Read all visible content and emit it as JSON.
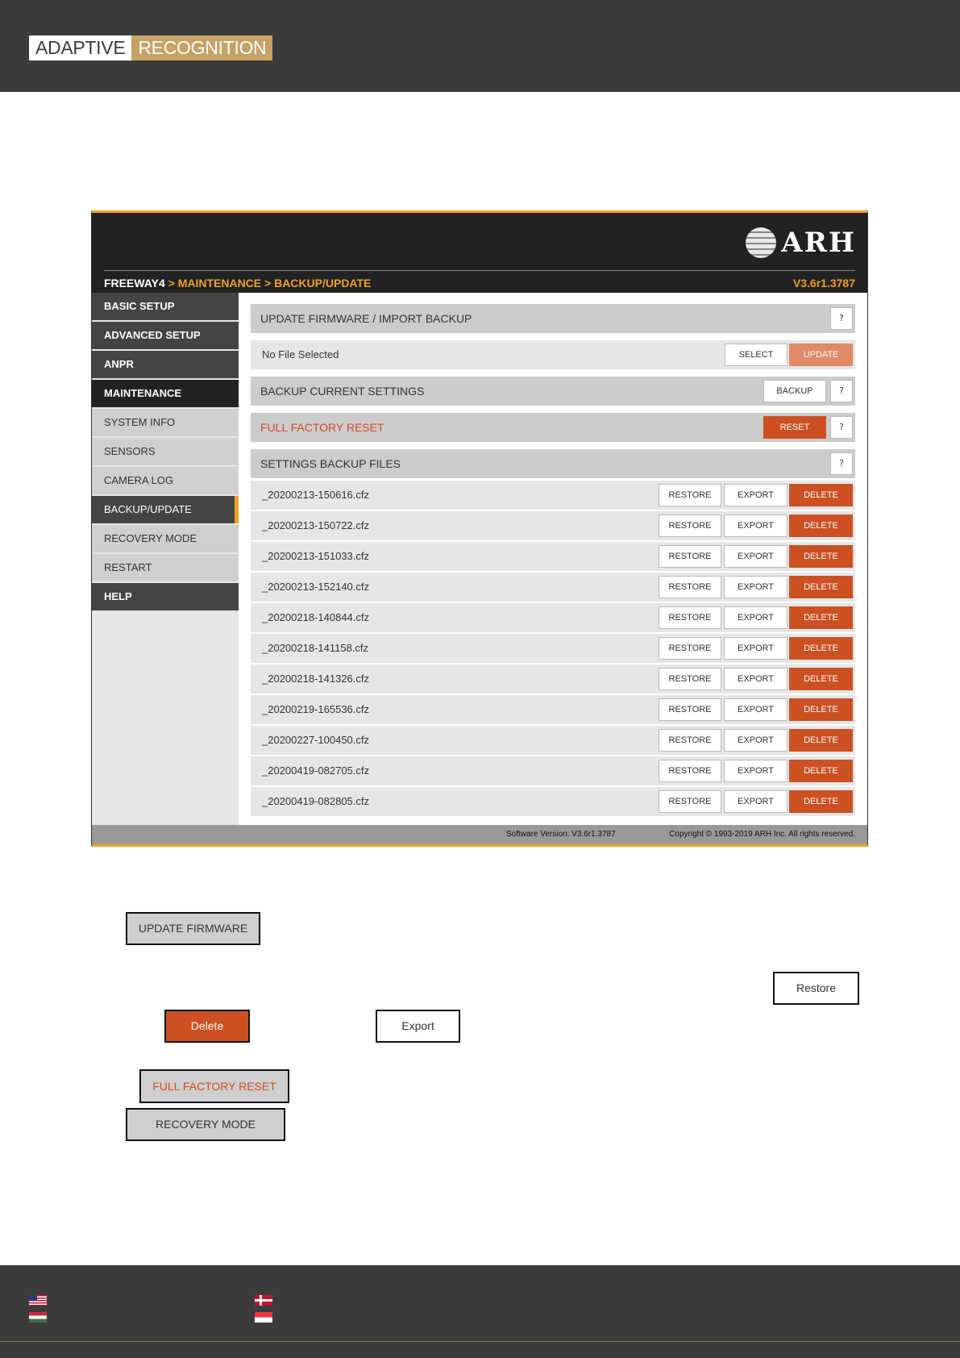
{
  "page_header": {
    "logo_part1": "ADAPTIVE",
    "logo_part2": "RECOGNITION"
  },
  "app": {
    "brand": "ARH",
    "breadcrumb_root": "FREEWAY4",
    "breadcrumb_rest": " > MAINTENANCE > BACKUP/UPDATE",
    "version": "V3.6r1.3787",
    "sidebar": [
      {
        "label": "BASIC SETUP"
      },
      {
        "label": "ADVANCED SETUP"
      },
      {
        "label": "ANPR"
      },
      {
        "label": "MAINTENANCE"
      },
      {
        "label": "SYSTEM INFO"
      },
      {
        "label": "SENSORS"
      },
      {
        "label": "CAMERA LOG"
      },
      {
        "label": "BACKUP/UPDATE"
      },
      {
        "label": "RECOVERY MODE"
      },
      {
        "label": "RESTART"
      },
      {
        "label": "HELP"
      }
    ],
    "update_section": {
      "title": "UPDATE FIRMWARE / IMPORT BACKUP",
      "help": "?"
    },
    "file_row": {
      "status": "No File Selected",
      "select": "SELECT",
      "update": "UPDATE"
    },
    "backup_section": {
      "title": "BACKUP CURRENT SETTINGS",
      "backup": "BACKUP",
      "help": "?"
    },
    "reset_section": {
      "title": "FULL FACTORY RESET",
      "reset": "RESET",
      "help": "?"
    },
    "files_section": {
      "title": "SETTINGS BACKUP FILES",
      "help": "?"
    },
    "row_buttons": {
      "restore": "RESTORE",
      "export": "EXPORT",
      "delete": "DELETE"
    },
    "files": [
      "_20200213-150616.cfz",
      "_20200213-150722.cfz",
      "_20200213-151033.cfz",
      "_20200213-152140.cfz",
      "_20200218-140844.cfz",
      "_20200218-141158.cfz",
      "_20200218-141326.cfz",
      "_20200219-165536.cfz",
      "_20200227-100450.cfz",
      "_20200419-082705.cfz",
      "_20200419-082805.cfz"
    ],
    "footer": {
      "software_version": "Software Version:   V3.6r1.3787",
      "copyright": "Copyright © 1993-2019 ARH Inc. All rights reserved."
    }
  },
  "samples": {
    "update_firmware": "UPDATE FIRMWARE",
    "restore": "Restore",
    "delete": "Delete",
    "export": "Export",
    "full_factory_reset": "FULL FACTORY RESET",
    "recovery_mode": "RECOVERY MODE"
  },
  "page_footer": {
    "flags": [
      "us-flag-icon",
      "dk-flag-icon",
      "hu-flag-icon",
      "sg-flag-icon"
    ]
  }
}
